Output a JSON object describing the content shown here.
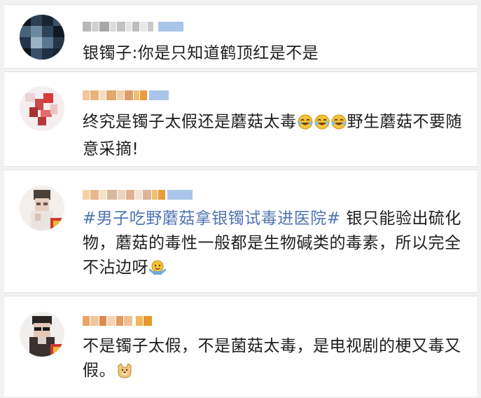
{
  "comments": [
    {
      "name": "",
      "text": "银镯子:你是只知道鹤顶红是不是"
    },
    {
      "name": "",
      "text_a": "终究是镯子太假还是蘑菇太毒",
      "emoji": "laughing-crying-emoji",
      "text_b": "野生蘑菇不要随意采摘!"
    },
    {
      "name": "",
      "topic": "#男子吃野蘑菇拿银镯试毒进医院#",
      "text": " 银只能验出硫化物，蘑菇的毒性一般都是生物碱类的毒素，所以完全不沾边呀",
      "emoji": "shrug-emoji"
    },
    {
      "name": "",
      "text": "不是镯子太假，不是菌菇太毒，是电视剧的梗又毒又假。",
      "emoji": "doge-emoji"
    }
  ],
  "colors": {
    "topic": "#4f75b3",
    "text": "#1e1e1e",
    "background": "#f1f1f1"
  }
}
